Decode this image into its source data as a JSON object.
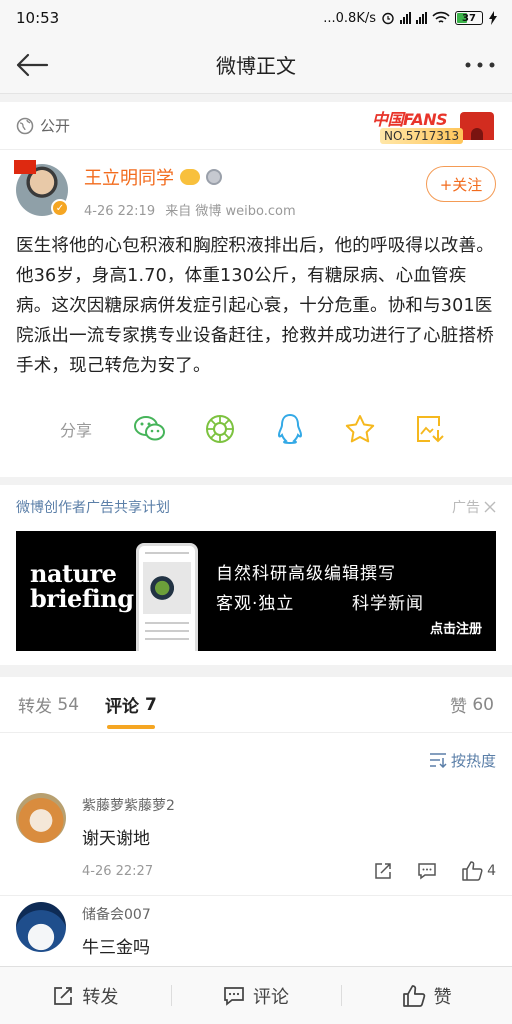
{
  "status_bar": {
    "time": "10:53",
    "speed": "...0.8K/s",
    "battery": "37"
  },
  "nav": {
    "title": "微博正文"
  },
  "post": {
    "visibility": "公开",
    "fans_badge": {
      "top": "中国FANS",
      "number": "NO.5717313"
    },
    "author": "王立明同学",
    "time": "4-26 22:19",
    "source": "来自 微博 weibo.com",
    "follow_label": "+关注",
    "text": "医生将他的心包积液和胸腔积液排出后，他的呼吸得以改善。他36岁，身高1.70，体重130公斤，有糖尿病、心血管疾病。这次因糖尿病併发症引起心衰，十分危重。协和与301医院派出一流专家携专业设备赶往，抢救并成功进行了心脏搭桥手术，现己转危为安了。",
    "share_label": "分享"
  },
  "ad": {
    "title": "微博创作者广告共享计划",
    "tag": "广告",
    "brand_line1": "nature",
    "brand_line2": "briefing",
    "line1": "自然科研高级编辑撰写",
    "line2a": "客观·独立",
    "line2b": "科学新闻",
    "cta": "点击注册"
  },
  "tabs": {
    "repost_label": "转发",
    "repost_count": "54",
    "comment_label": "评论",
    "comment_count": "7",
    "like_label": "赞",
    "like_count": "60"
  },
  "sort_label": "按热度",
  "comments": [
    {
      "name": "紫藤萝紫藤萝2",
      "text": "谢天谢地",
      "time": "4-26 22:27",
      "likes": "4"
    },
    {
      "name": "储备会007",
      "text": "牛三金吗"
    }
  ],
  "bottom": {
    "repost": "转发",
    "comment": "评论",
    "like": "赞"
  },
  "colors": {
    "accent": "#f26b1d",
    "link": "#5b7fa8",
    "tab_underline": "#f5a623"
  }
}
